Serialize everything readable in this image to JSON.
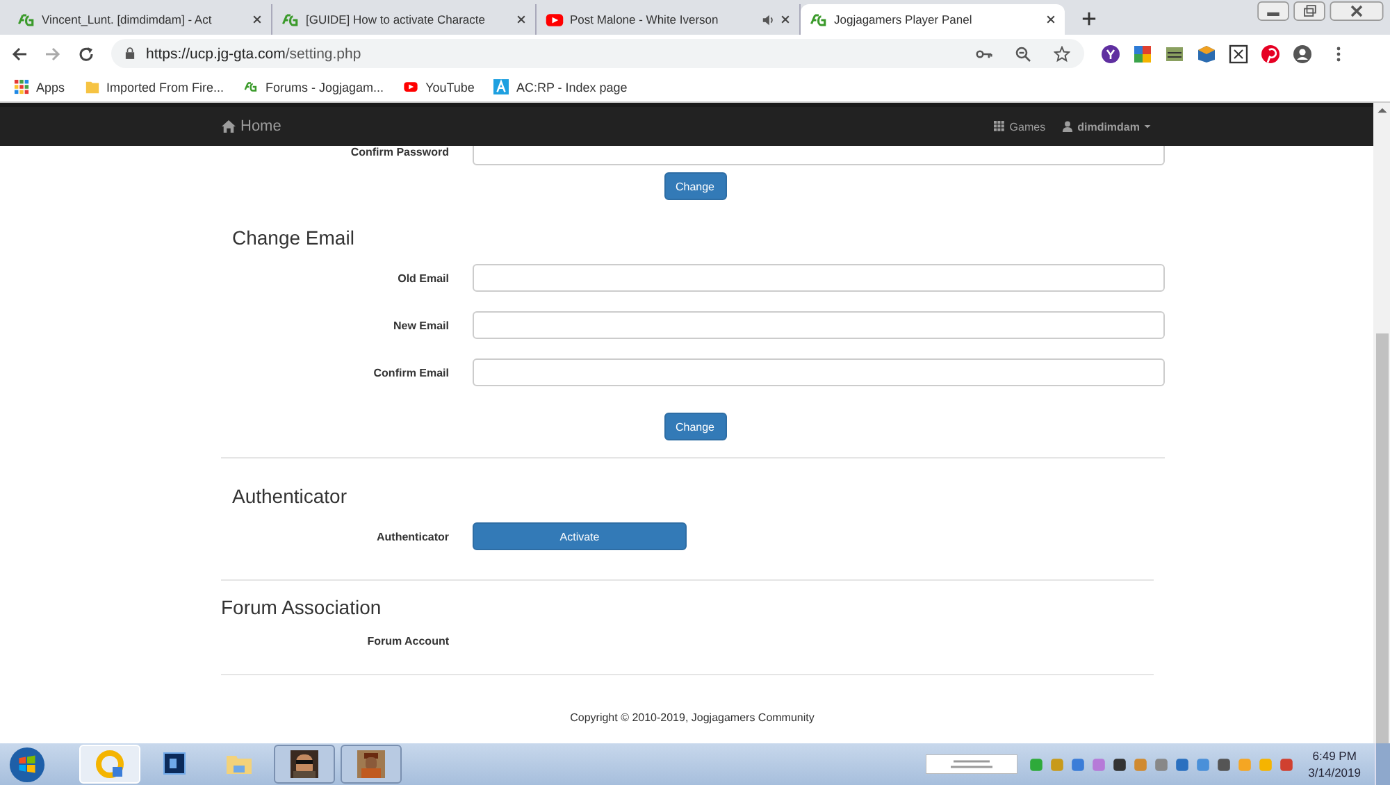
{
  "browser": {
    "tabs": [
      {
        "title": "Vincent_Lunt. [dimdimdam] - Act",
        "kind": "jg",
        "audio": false,
        "selected": false
      },
      {
        "title": "[GUIDE] How to activate Characte",
        "kind": "jg",
        "audio": false,
        "selected": false
      },
      {
        "title": "Post Malone - White Iverson",
        "kind": "youtube",
        "audio": true,
        "selected": false
      },
      {
        "title": "Jogjagamers Player Panel",
        "kind": "jg",
        "audio": false,
        "selected": true
      }
    ],
    "url": {
      "host": "https://ucp.jg-gta.com",
      "path": "/setting.php"
    },
    "bookmarks": [
      {
        "label": "Apps",
        "kind": "apps"
      },
      {
        "label": "Imported From Fire...",
        "kind": "folder"
      },
      {
        "label": "Forums - Jogjagam...",
        "kind": "jg"
      },
      {
        "label": "YouTube",
        "kind": "youtube"
      },
      {
        "label": "AC:RP - Index page",
        "kind": "letter"
      }
    ]
  },
  "navbar": {
    "home": "Home",
    "games": "Games",
    "user": "dimdimdam"
  },
  "password_section": {
    "label": "Confirm Password",
    "button": "Change"
  },
  "email_section": {
    "title": "Change Email",
    "fields": [
      {
        "label": "Old Email"
      },
      {
        "label": "New Email"
      },
      {
        "label": "Confirm Email"
      }
    ],
    "button": "Change"
  },
  "authenticator_section": {
    "title": "Authenticator",
    "label": "Authenticator",
    "button": "Activate"
  },
  "forum_section": {
    "title": "Forum Association",
    "label": "Forum Account"
  },
  "footer": "Copyright © 2010-2019, Jogjagamers Community",
  "taskbar": {
    "time": "6:49 PM",
    "date": "3/14/2019"
  }
}
